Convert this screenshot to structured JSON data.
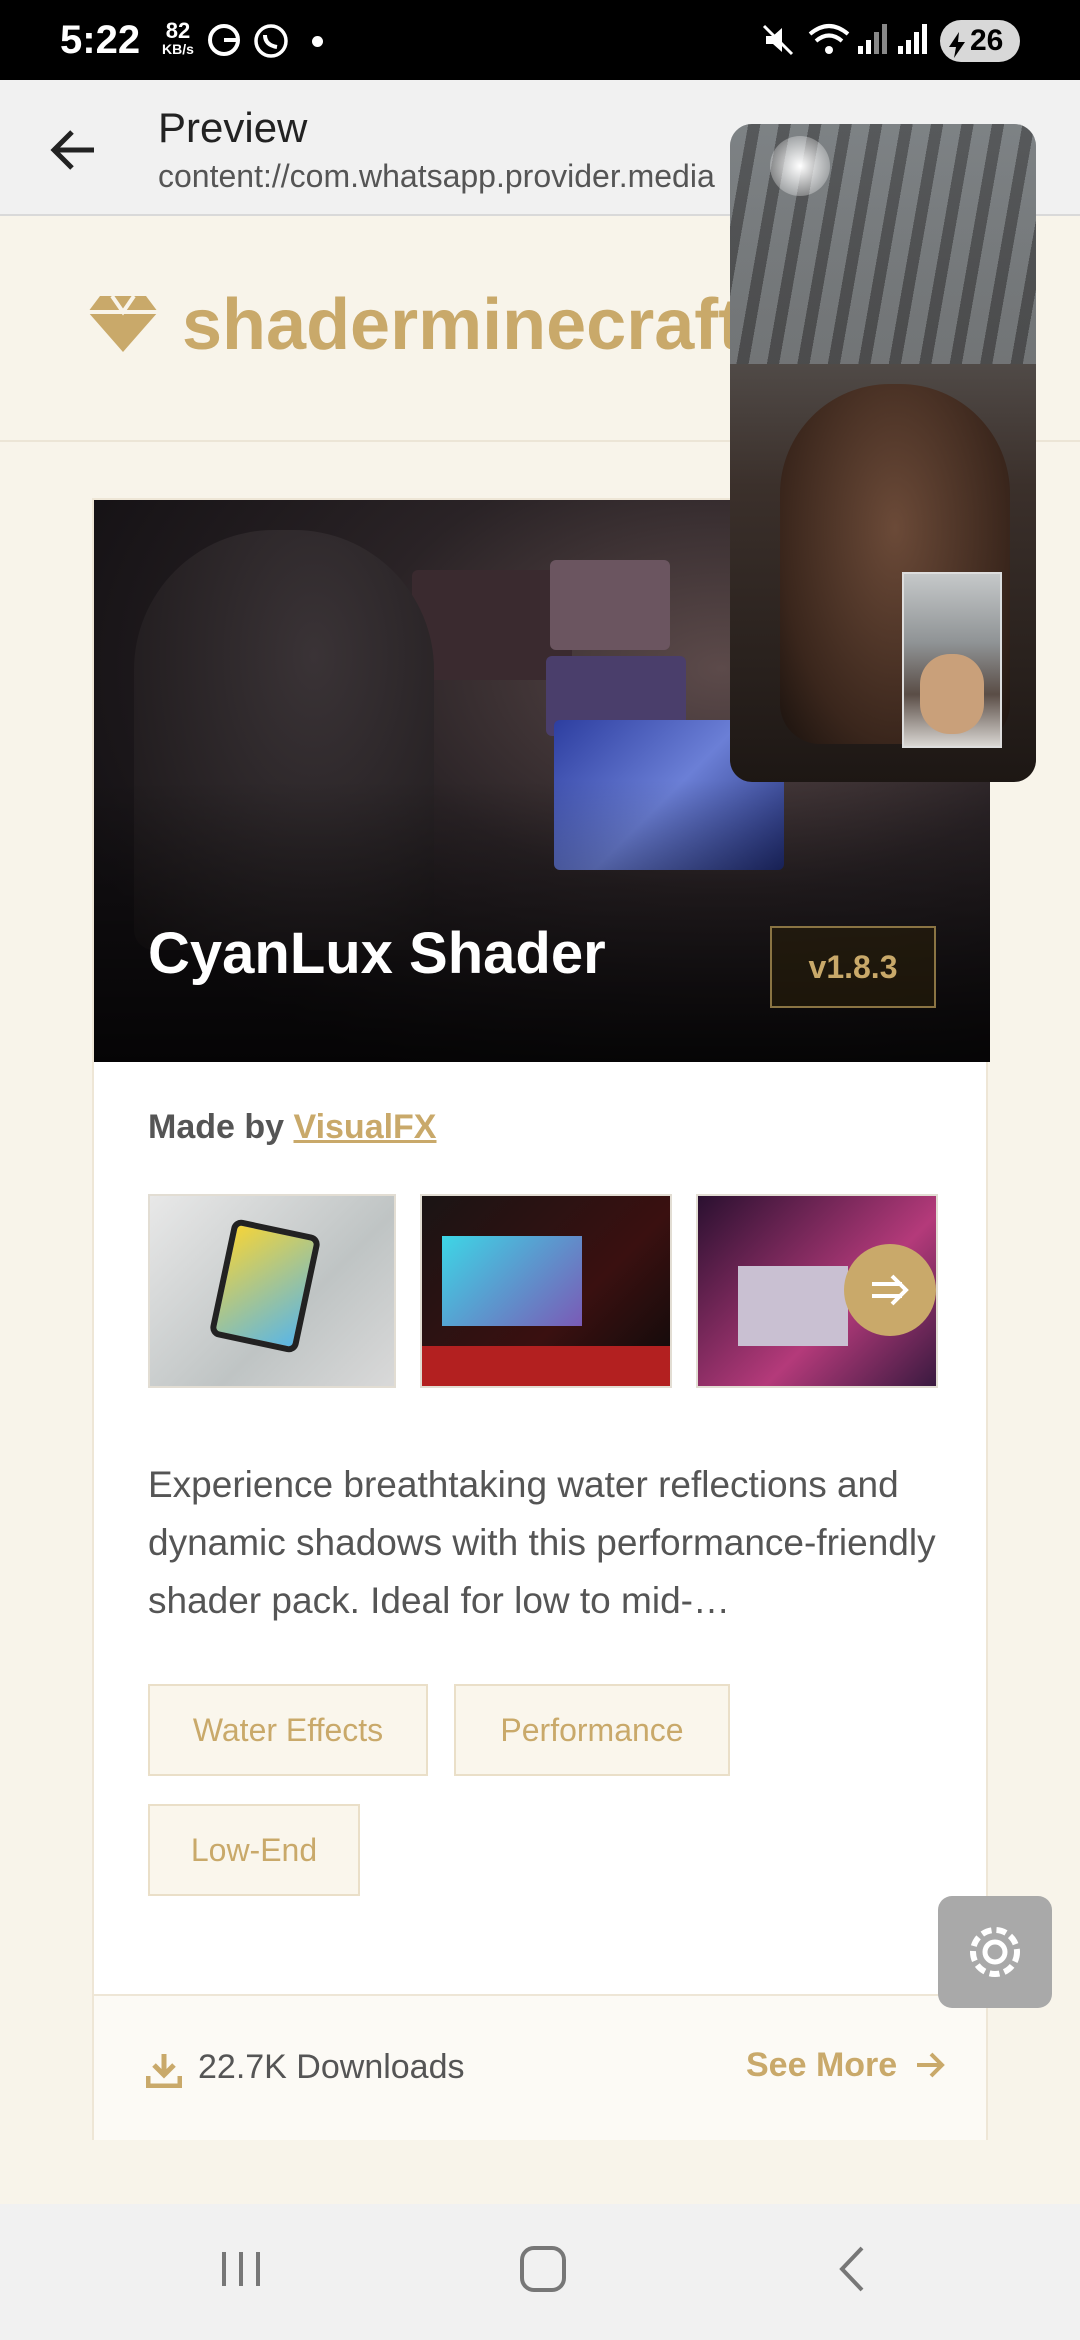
{
  "status_bar": {
    "time": "5:22",
    "speed_value": "82",
    "speed_unit": "KB/s",
    "battery": "26"
  },
  "app_bar": {
    "title": "Preview",
    "subtitle": "content://com.whatsapp.provider.media"
  },
  "site": {
    "name": "shaderminecraft.com",
    "brand_color": "#c9a96a"
  },
  "card": {
    "title": "CyanLux Shader",
    "version": "v1.8.3",
    "made_by_prefix": "Made by",
    "author": "VisualFX",
    "description": "Experience breathtaking water reflections and dynamic shadows with this performance-friendly shader pack. Ideal for low to mid-…",
    "tags": [
      "Water Effects",
      "Performance",
      "Low-End"
    ],
    "downloads": "22.7K Downloads",
    "see_more": "See More"
  },
  "icons": {
    "back": "arrow-left-icon",
    "brand": "gem-icon",
    "next": "arrow-right-icon",
    "download": "download-icon",
    "settings": "gear-icon"
  }
}
